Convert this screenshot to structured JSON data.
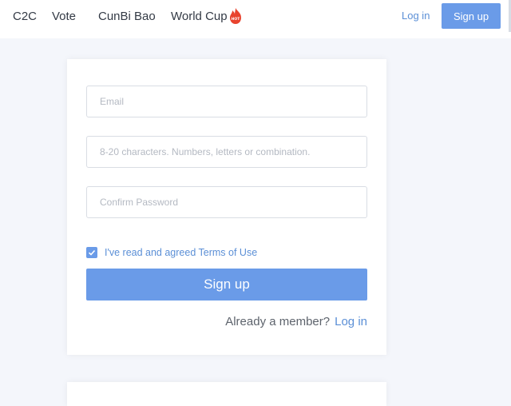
{
  "nav": {
    "items": [
      {
        "label": "C2C"
      },
      {
        "label": "Vote"
      },
      {
        "label": "CunBi Bao"
      },
      {
        "label": "World Cup"
      }
    ],
    "hot_badge": "HOT",
    "login": "Log in",
    "signup": "Sign up"
  },
  "form": {
    "email_placeholder": "Email",
    "email_value": "",
    "password_placeholder": "8-20 characters. Numbers, letters or combination.",
    "password_value": "",
    "confirm_placeholder": "Confirm Password",
    "confirm_value": "",
    "agree_checked": true,
    "agree_text": "I've read and agreed Terms of Use",
    "submit": "Sign up",
    "member_text": "Already a member?",
    "member_login": "Log in"
  },
  "colors": {
    "accent": "#6a9be8",
    "link": "#5b8fd6",
    "hot": "#e8432e"
  }
}
